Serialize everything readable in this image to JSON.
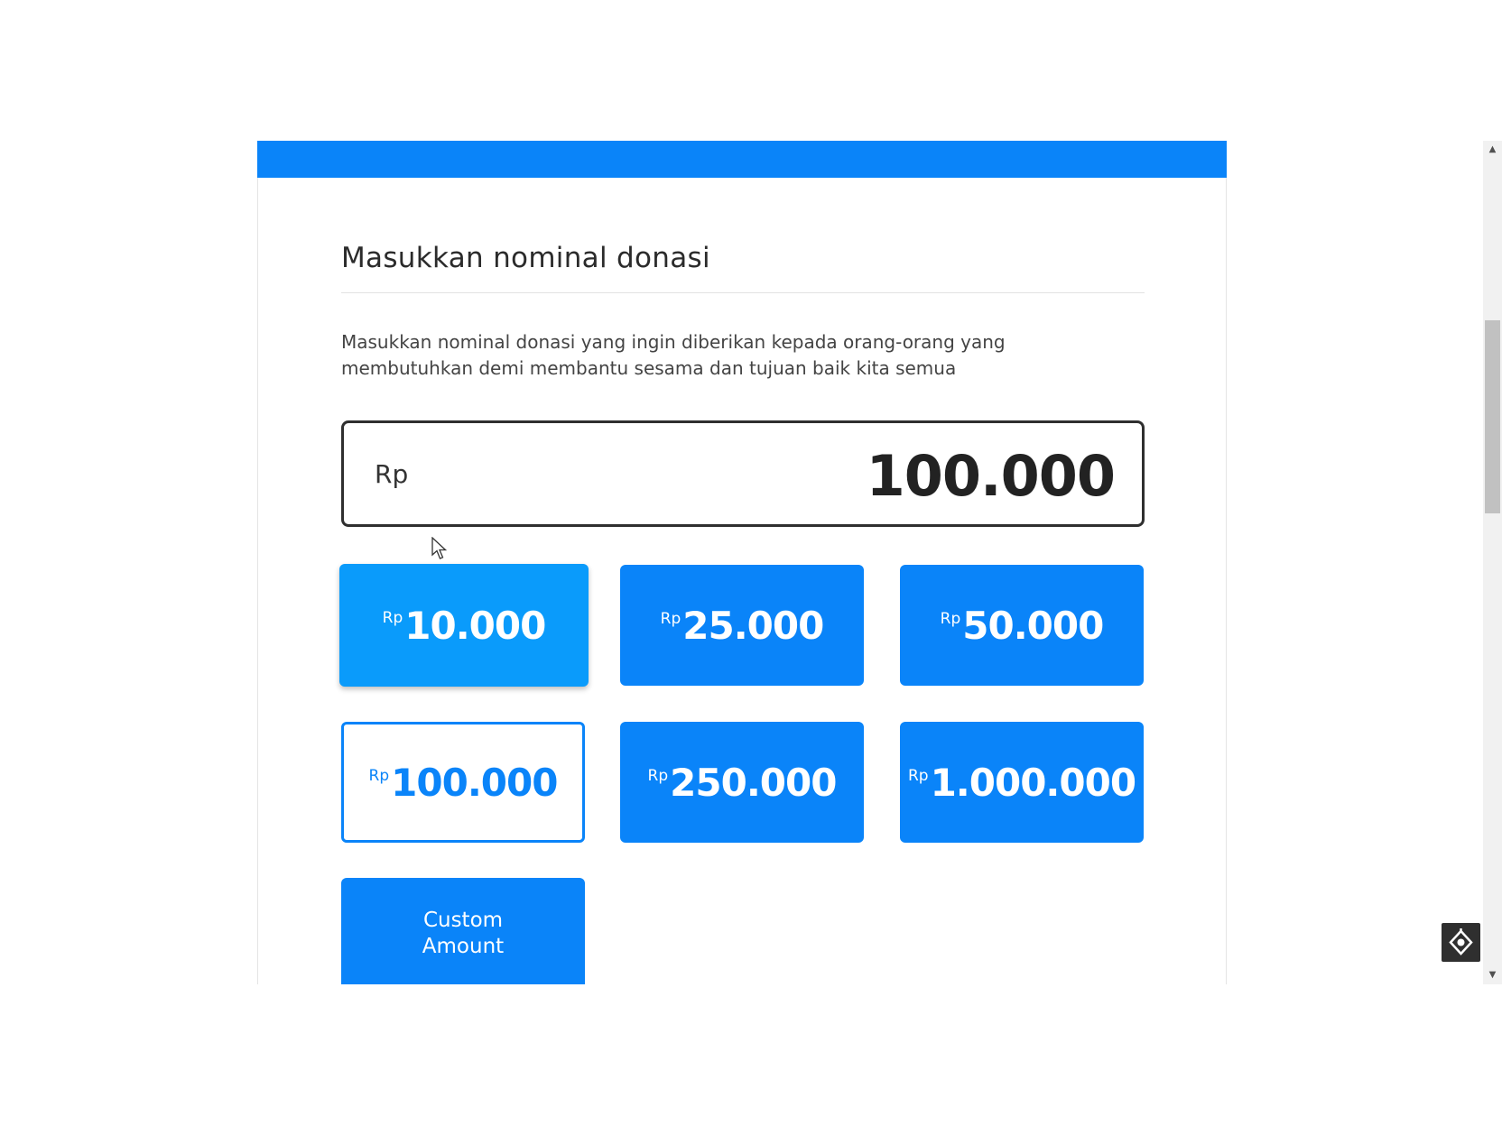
{
  "section": {
    "title": "Masukkan nominal donasi",
    "description": "Masukkan nominal donasi yang ingin diberikan kepada orang-orang yang membutuhkan demi membantu sesama dan tujuan baik kita semua"
  },
  "amount_input": {
    "currency": "Rp",
    "value": "100.000"
  },
  "presets": [
    {
      "currency": "Rp",
      "amount": "10.000",
      "state": "hovered"
    },
    {
      "currency": "Rp",
      "amount": "25.000",
      "state": "default"
    },
    {
      "currency": "Rp",
      "amount": "50.000",
      "state": "default"
    },
    {
      "currency": "Rp",
      "amount": "100.000",
      "state": "selected"
    },
    {
      "currency": "Rp",
      "amount": "250.000",
      "state": "default"
    },
    {
      "currency": "Rp",
      "amount": "1.000.000",
      "state": "default"
    }
  ],
  "custom_button": {
    "line1": "Custom",
    "line2": "Amount"
  },
  "colors": {
    "primary": "#0a84f9",
    "hover": "#0a9bfb",
    "text_dark": "#222222"
  },
  "icons": {
    "scroll_up": "scroll-up-icon",
    "scroll_down": "scroll-down-icon",
    "floating_widget": "widget-icon"
  }
}
